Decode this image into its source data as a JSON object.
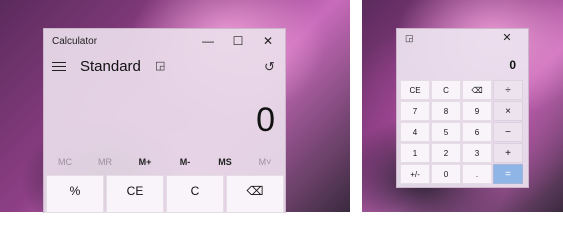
{
  "standard": {
    "title": "Calculator",
    "window_controls": {
      "minimize": "—",
      "maximize": "☐",
      "close": "✕"
    },
    "mode": "Standard",
    "display": "0",
    "memory": [
      {
        "label": "MC",
        "enabled": false
      },
      {
        "label": "MR",
        "enabled": false
      },
      {
        "label": "M+",
        "enabled": true
      },
      {
        "label": "M-",
        "enabled": true
      },
      {
        "label": "MS",
        "enabled": true
      },
      {
        "label": "M˅",
        "enabled": false
      }
    ],
    "keys": [
      "%",
      "CE",
      "C",
      "⌫"
    ]
  },
  "compact": {
    "display": "0",
    "close": "✕",
    "keys": [
      [
        "CE",
        "C",
        "⌫",
        "÷"
      ],
      [
        "7",
        "8",
        "9",
        "×"
      ],
      [
        "4",
        "5",
        "6",
        "−"
      ],
      [
        "1",
        "2",
        "3",
        "+"
      ],
      [
        "+/-",
        "0",
        ".",
        "="
      ]
    ]
  },
  "colors": {
    "equals": "#8fb4e6"
  },
  "icons": {
    "menu": "hamburger-icon",
    "keep_on_top": "keep-on-top-icon",
    "history": "history-icon",
    "backspace": "backspace-icon"
  }
}
